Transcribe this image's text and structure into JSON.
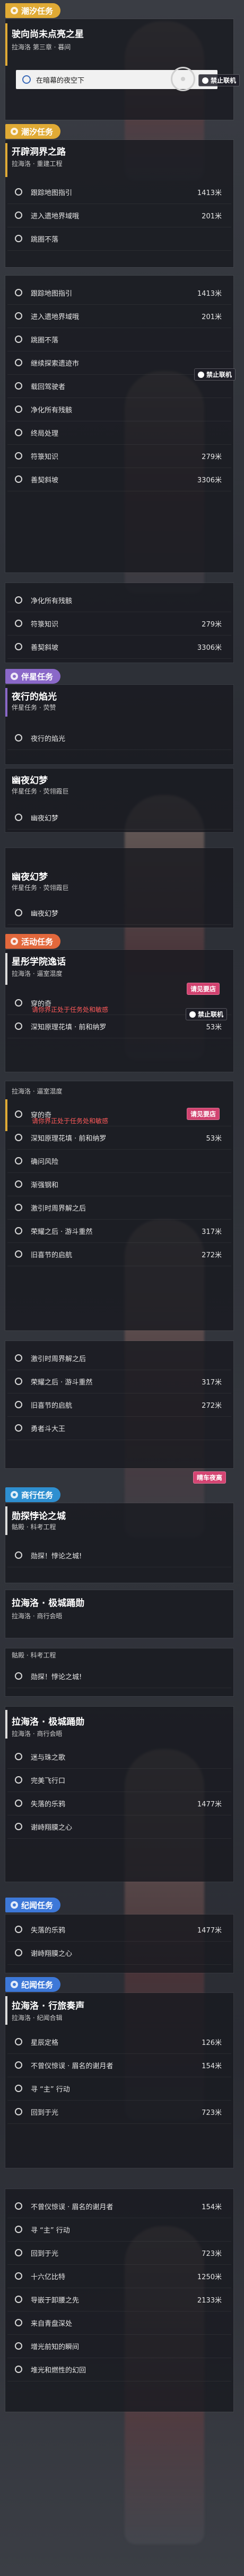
{
  "header": {
    "category": "潮汐任务",
    "title": "驶向尚未点亮之星",
    "subtitle": "拉海洛 第三章 · 暮间",
    "tooltip": "在暗幕的夜空下",
    "badge": "禁止联机"
  },
  "main1": {
    "category": "潮汐任务",
    "title": "开辟洞界之路",
    "subtitle": "拉海洛 · 重建工程",
    "steps": [
      {
        "text": "跟踪地图指引",
        "dist": "1413米"
      },
      {
        "text": "进入遗地界域哦",
        "dist": "201米"
      },
      {
        "text": "跳圈不落",
        "dist": ""
      }
    ]
  },
  "scroll1": {
    "steps": [
      {
        "text": "跟踪地图指引",
        "dist": "1413米"
      },
      {
        "text": "进入遗地界域哦",
        "dist": "201米"
      },
      {
        "text": "跳圈不落",
        "dist": ""
      },
      {
        "text": "继续探索遗迹市",
        "dist": ""
      },
      {
        "text": "载回驾驶者",
        "dist": ""
      },
      {
        "text": "净化所有残骸",
        "dist": ""
      },
      {
        "text": "终局处理",
        "dist": ""
      },
      {
        "text": "符箓知识",
        "dist": "279米"
      },
      {
        "text": "善契斜坡",
        "dist": "3306米"
      }
    ],
    "badge": "禁止联机"
  },
  "scroll2": {
    "steps": [
      {
        "text": "净化所有残骸",
        "dist": ""
      },
      {
        "text": "符箓知识",
        "dist": "279米"
      },
      {
        "text": "善契斜坡",
        "dist": "3306米"
      }
    ]
  },
  "companion": {
    "category": "伴星任务",
    "q1": {
      "title": "夜行的焰光",
      "subtitle": "伴星任务 · 荧赞",
      "step": "夜行的焰光"
    },
    "q2": {
      "title": "幽夜幻梦",
      "subtitle": "伴星任务 · 荧翎霞巨",
      "step": "幽夜幻梦"
    },
    "q3": {
      "title": "幽夜幻梦",
      "subtitle": "伴星任务 · 荧翎霞巨",
      "step": "幽夜幻梦"
    }
  },
  "event": {
    "category": "活动任务",
    "title": "星彤学院逸话",
    "subtitle": "拉海洛 · 逼室混度",
    "steps": [
      {
        "text": "穿的奇",
        "dist": ""
      },
      {
        "text": "深知原理花填 · 前和纳罗",
        "dist": "53米"
      }
    ],
    "warning": "请你界正处于任务处和敏感",
    "badge": "禁止联机",
    "badge2": "请见要店"
  },
  "event2": {
    "header": "拉海洛 · 逼室混度",
    "steps": [
      {
        "text": "穿的奇",
        "dist": ""
      },
      {
        "text": "深知原理花填 · 前和纳罗",
        "dist": "53米"
      },
      {
        "text": "确问风险",
        "dist": ""
      },
      {
        "text": "渐强钢和",
        "dist": ""
      },
      {
        "text": "激引时周界解之后",
        "dist": ""
      },
      {
        "text": "荣耀之后 · 游斗重然",
        "dist": "317米"
      },
      {
        "text": "旧喜节的启航",
        "dist": "272米"
      }
    ],
    "warning": "请你界正处于任务处和敏感",
    "badge": "请见要店"
  },
  "event3": {
    "steps": [
      {
        "text": "激引时周界解之后",
        "dist": ""
      },
      {
        "text": "荣耀之后 · 游斗重然",
        "dist": "317米"
      },
      {
        "text": "旧喜节的启航",
        "dist": "272米"
      },
      {
        "text": "勇者斗大王",
        "dist": ""
      }
    ],
    "badge": "晴车夜离"
  },
  "daily": {
    "category": "商行任务",
    "title": "勋探悖论之城",
    "subtitle": "骷殿 · 科考工程",
    "step": "勋探！悖论之城!"
  },
  "daily2": {
    "title": "拉海洛 · 极城踊勋",
    "subtitle": "拉海洛 · 商行会晤"
  },
  "daily3": {
    "header": "骷殿 · 科考工程",
    "step": "勋探！悖论之城!"
  },
  "daily4": {
    "title": "拉海洛 · 极城踊勋",
    "subtitle": "拉海洛 · 商行会晤",
    "steps": [
      {
        "text": "迷与珠之歌",
        "dist": ""
      },
      {
        "text": "完美飞行口",
        "dist": ""
      },
      {
        "text": "失落的乐鸦",
        "dist": "1477米"
      },
      {
        "text": "谢峙翔膜之心",
        "dist": ""
      }
    ]
  },
  "epic": {
    "category": "纪闻任务",
    "steps": [
      {
        "text": "失落的乐鸦",
        "dist": "1477米"
      },
      {
        "text": "谢峙翔膜之心",
        "dist": ""
      }
    ]
  },
  "epic2": {
    "category": "纪闻任务",
    "title": "拉海洛 · 行旅奏声",
    "subtitle": "拉海洛 · 纪闻合辑",
    "steps": [
      {
        "text": "星辰定格",
        "dist": "126米"
      },
      {
        "text": "不曾仪惊误 · 眉名的谢月者",
        "dist": "154米"
      },
      {
        "text": "寻 “主” 行动",
        "dist": ""
      },
      {
        "text": "回到于光",
        "dist": "723米"
      }
    ]
  },
  "epic3": {
    "steps": [
      {
        "text": "不曾仪惊误 · 眉名的谢月者",
        "dist": "154米"
      },
      {
        "text": "寻 “主” 行动",
        "dist": ""
      },
      {
        "text": "回到于光",
        "dist": "723米"
      },
      {
        "text": "十六亿比特",
        "dist": "1250米"
      },
      {
        "text": "导嵌于卸腰之先",
        "dist": "2133米"
      },
      {
        "text": "来自青盘深处",
        "dist": ""
      },
      {
        "text": "增光前知的瞬间",
        "dist": ""
      },
      {
        "text": "堆光和燃性的幻回",
        "dist": ""
      }
    ]
  },
  "colors": {
    "main": "#e0aa35",
    "companion": "#8a68c8",
    "event": "#e2683c",
    "daily": "#2e8fd0",
    "epic": "#3d78d8"
  }
}
